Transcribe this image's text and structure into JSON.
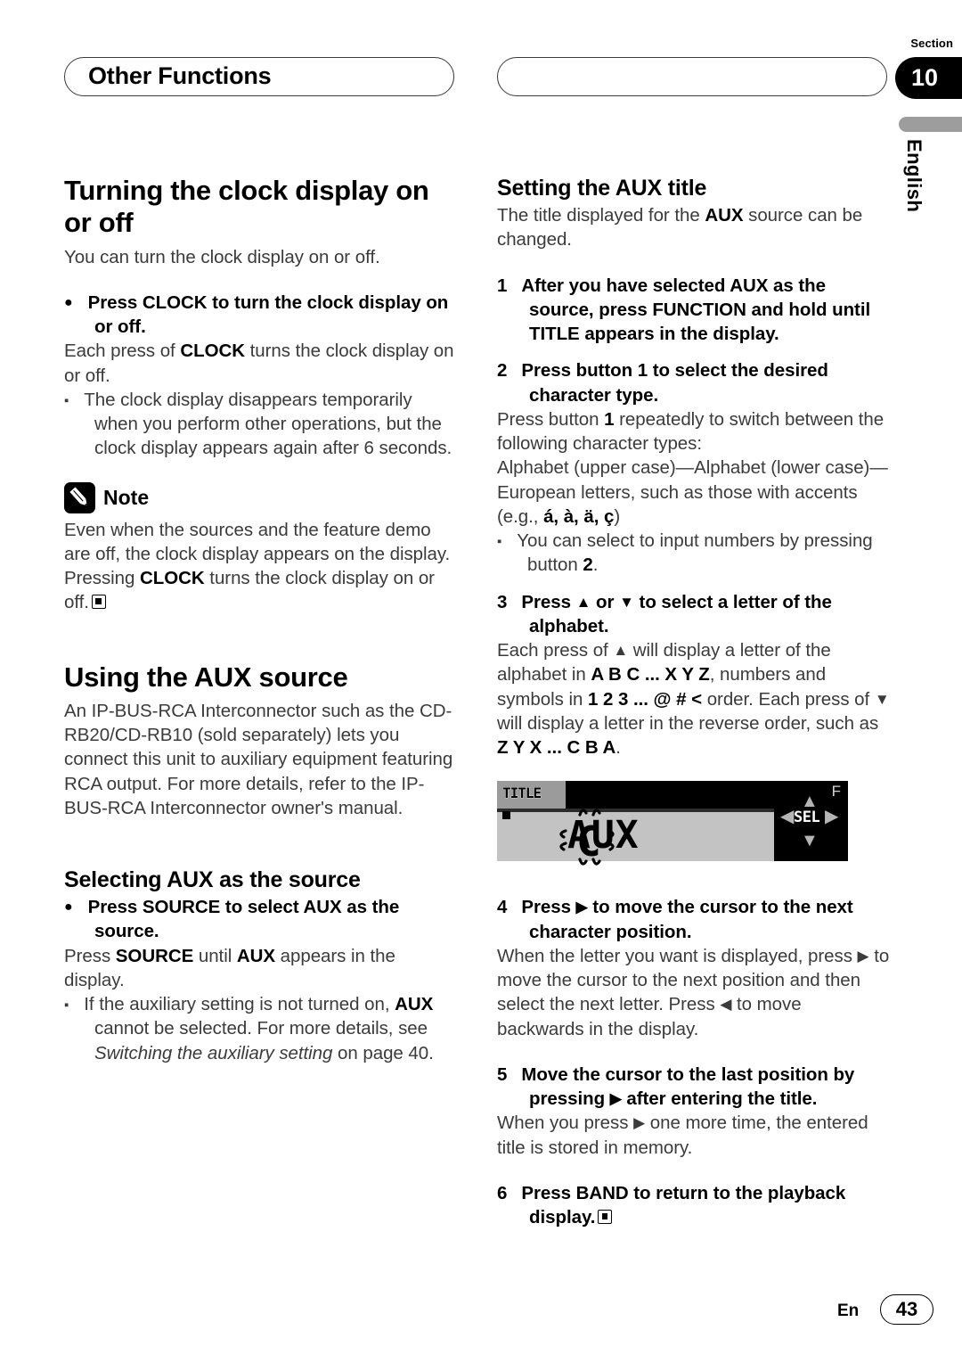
{
  "header": {
    "left_title": "Other Functions",
    "right_title": "",
    "section_label": "Section",
    "section_number": "10",
    "language": "English"
  },
  "left_column": {
    "heading": "Turning the clock display on or off",
    "intro": "You can turn the clock display on or off.",
    "bullet1": {
      "title": "Press CLOCK to turn the clock display on or off.",
      "body_prefix": "Each press of ",
      "body_bold": "CLOCK",
      "body_suffix": " turns the clock display on or off."
    },
    "note_item": "The clock display disappears temporarily when you perform other operations, but the clock display appears again after 6 seconds.",
    "note": {
      "label": "Note",
      "line1": "Even when the sources and the feature demo are off, the clock display appears on the display. Pressing ",
      "bold1": "CLOCK",
      "line2": " turns the clock display on or off."
    },
    "aux_heading": "Using the AUX source",
    "aux_body": "An IP-BUS-RCA Interconnector such as the CD-RB20/CD-RB10 (sold separately) lets you connect this unit to auxiliary equipment featuring RCA output. For more details, refer to the IP-BUS-RCA Interconnector owner's manual.",
    "selecting_heading": "Selecting AUX as the source",
    "selecting_bullet": "Press SOURCE to select AUX as the source.",
    "selecting_body": {
      "p1": "Press ",
      "b1": "SOURCE",
      "p2": " until ",
      "b2": "AUX",
      "p3": " appears in the display."
    },
    "selecting_note": {
      "p1": "If the auxiliary setting is not turned on, ",
      "b1": "AUX",
      "p2": " cannot be selected. For more details, see ",
      "i1": "Switching the auxiliary setting",
      "p3": " on page 40."
    }
  },
  "right_column": {
    "heading": "Setting the AUX title",
    "intro": {
      "p1": "The title displayed for the ",
      "b1": "AUX",
      "p2": " source can be changed."
    },
    "steps": [
      {
        "number": "1",
        "title": "After you have selected AUX as the source, press FUNCTION and hold until TITLE appears in the display."
      },
      {
        "number": "2",
        "title": "Press button 1 to select the desired character type.",
        "body": {
          "p1": "Press button ",
          "b1": "1",
          "p2": " repeatedly to switch between the following character types:"
        },
        "body2": "Alphabet (upper case)—Alphabet (lower case)—European letters, such as those with accents (e.g., ",
        "body2_bold": "á, à, ä, ç",
        "body2_tail": ")",
        "note": {
          "p1": "You can select to input numbers by pressing button ",
          "b1": "2",
          "p2": "."
        }
      },
      {
        "number": "3",
        "title_p1": "Press ",
        "title_up": "▲",
        "title_p2": " or ",
        "title_down": "▼",
        "title_p3": " to select a letter of the alphabet.",
        "body": {
          "p1": "Each press of ",
          "a1": "▲",
          "p2": " will display a letter of the alphabet in ",
          "b1": "A B C ... X Y Z",
          "p3": ", numbers and symbols in ",
          "b2": "1 2 3 ... @ # <",
          "p4": " order. Each press of ",
          "a2": "▼",
          "p5": " will display a letter in the reverse order, such as ",
          "b3": "Z Y X ... C B A",
          "p6": "."
        }
      },
      {
        "number": "4",
        "title_p1": "Press ",
        "title_arrow": "▶",
        "title_p2": " to move the cursor to the next character position.",
        "body": {
          "p1": "When the letter you want is displayed, press ",
          "a1": "▶",
          "p2": " to move the cursor to the next position and then select the next letter. Press ",
          "a2": "◀",
          "p3": " to move backwards in the display."
        }
      },
      {
        "number": "5",
        "title_p1": "Move the cursor to the last position by pressing ",
        "title_arrow": "▶",
        "title_p2": " after entering the title.",
        "body": {
          "p1": "When you press ",
          "a1": "▶",
          "p2": " one more time, the entered title is stored in memory."
        }
      },
      {
        "number": "6",
        "title": "Press BAND to return to the playback display."
      }
    ],
    "lcd": {
      "title_badge": "TITLE",
      "cursor_char": "C",
      "display_text": "AUX",
      "sel_label": "SEL",
      "f_label": "F",
      "arrow_up": "▲",
      "arrow_down": "▼",
      "arrow_left": "◀",
      "arrow_right": "▶"
    }
  },
  "footer": {
    "language_code": "En",
    "page_number": "43"
  },
  "colors": {
    "black": "#000000",
    "body_text": "#3b3b3b",
    "lcd_gray": "#c3c3c3",
    "badge_gray": "#9b9b9b",
    "lang_bar_gray": "#9d9d9d"
  }
}
